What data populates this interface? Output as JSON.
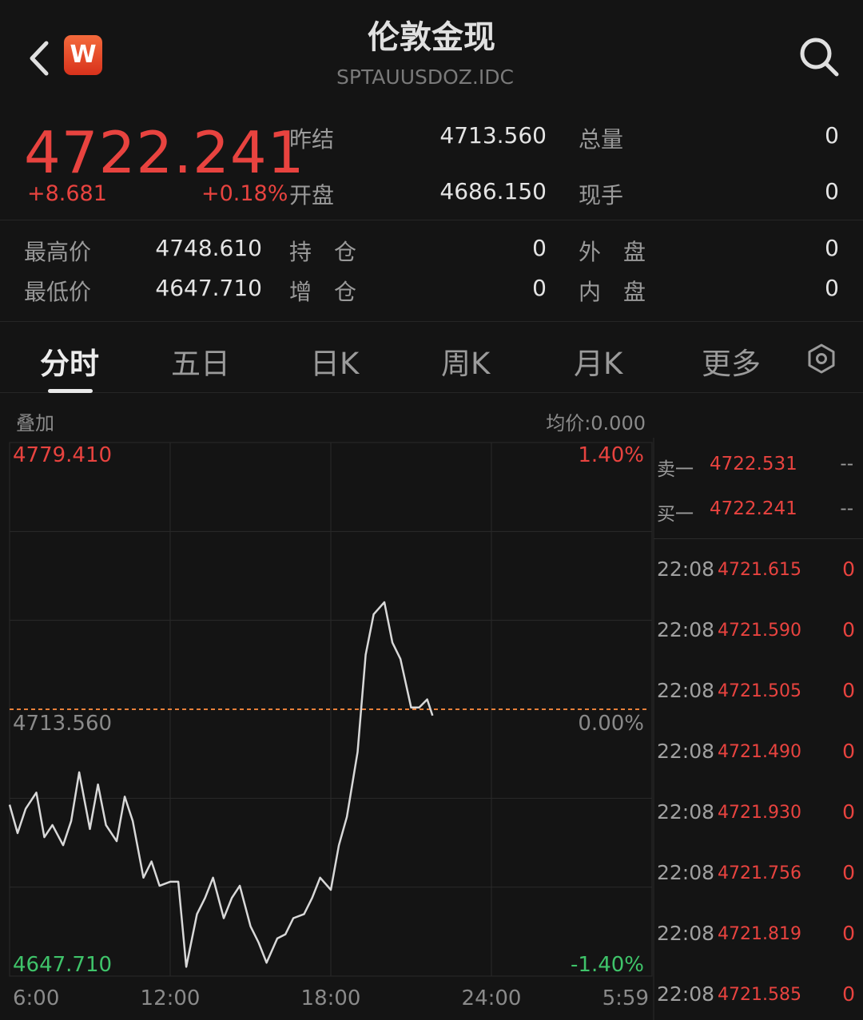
{
  "header": {
    "title": "伦敦金现",
    "subtitle": "SPTAUUSDOZ.IDC",
    "logo_letter": "W"
  },
  "quote": {
    "price": "4722.241",
    "change": "+8.681",
    "change_pct": "+0.18%",
    "fields": [
      {
        "label": "昨结",
        "value": "4713.560"
      },
      {
        "label": "开盘",
        "value": "4686.150"
      },
      {
        "label": "总量",
        "value": "0"
      },
      {
        "label": "现手",
        "value": "0"
      }
    ]
  },
  "stats": [
    {
      "label": "最高价",
      "value": "4748.610"
    },
    {
      "label": "最低价",
      "value": "4647.710"
    },
    {
      "label": "持　仓",
      "value": "0"
    },
    {
      "label": "增　仓",
      "value": "0"
    },
    {
      "label": "外　盘",
      "value": "0"
    },
    {
      "label": "内　盘",
      "value": "0"
    }
  ],
  "tabs": [
    "分时",
    "五日",
    "日K",
    "周K",
    "月K",
    "更多"
  ],
  "chart_toolbar": {
    "overlay": "叠加",
    "avg_price": "均价:0.000"
  },
  "chart_data": {
    "type": "line",
    "y_labels_left": [
      "4779.410",
      "4713.560",
      "4647.710"
    ],
    "y_labels_right": [
      "1.40%",
      "0.00%",
      "-1.40%"
    ],
    "x_labels": [
      "6:00",
      "12:00",
      "18:00",
      "24:00",
      "5:59"
    ],
    "ylim": [
      4647.71,
      4779.41
    ],
    "reference_price": 4713.56,
    "series": [
      {
        "color": "#d8d8d8",
        "x": [
          6.0,
          6.3,
          6.6,
          7.0,
          7.3,
          7.6,
          8.0,
          8.3,
          8.6,
          9.0,
          9.3,
          9.6,
          10.0,
          10.3,
          10.6,
          11.0,
          11.3,
          11.6,
          12.0,
          12.3,
          12.6,
          13.0,
          13.3,
          13.6,
          14.0,
          14.3,
          14.6,
          15.0,
          15.3,
          15.6,
          16.0,
          16.3,
          16.6,
          17.0,
          17.3,
          17.6,
          18.0,
          18.3,
          18.6,
          19.0,
          19.3,
          19.6,
          20.0,
          20.3,
          20.6,
          21.0,
          21.3,
          21.6,
          21.8
        ],
        "values": [
          4690,
          4683,
          4689,
          4693,
          4682,
          4685,
          4680,
          4686,
          4698,
          4684,
          4695,
          4685,
          4681,
          4692,
          4686,
          4672,
          4676,
          4670,
          4671,
          4671,
          4650,
          4663,
          4667,
          4672,
          4662,
          4667,
          4670,
          4660,
          4656,
          4651,
          4657,
          4658,
          4662,
          4663,
          4667,
          4672,
          4669,
          4680,
          4687,
          4703,
          4727,
          4737,
          4740,
          4730,
          4726,
          4714,
          4714,
          4716,
          4712
        ]
      }
    ]
  },
  "order_book": [
    {
      "label": "卖一",
      "price": "4722.531",
      "volume": "--"
    },
    {
      "label": "买一",
      "price": "4722.241",
      "volume": "--"
    }
  ],
  "ticks": [
    {
      "time": "22:08",
      "price": "4721.615",
      "volume": "0"
    },
    {
      "time": "22:08",
      "price": "4721.590",
      "volume": "0"
    },
    {
      "time": "22:08",
      "price": "4721.505",
      "volume": "0"
    },
    {
      "time": "22:08",
      "price": "4721.490",
      "volume": "0"
    },
    {
      "time": "22:08",
      "price": "4721.930",
      "volume": "0"
    },
    {
      "time": "22:08",
      "price": "4721.756",
      "volume": "0"
    },
    {
      "time": "22:08",
      "price": "4721.819",
      "volume": "0"
    },
    {
      "time": "22:08",
      "price": "4721.585",
      "volume": "0"
    }
  ],
  "colors": {
    "up": "#e8433f",
    "down": "#3fc46a",
    "line": "#d8d8d8",
    "reference_line": "#e8803a"
  }
}
